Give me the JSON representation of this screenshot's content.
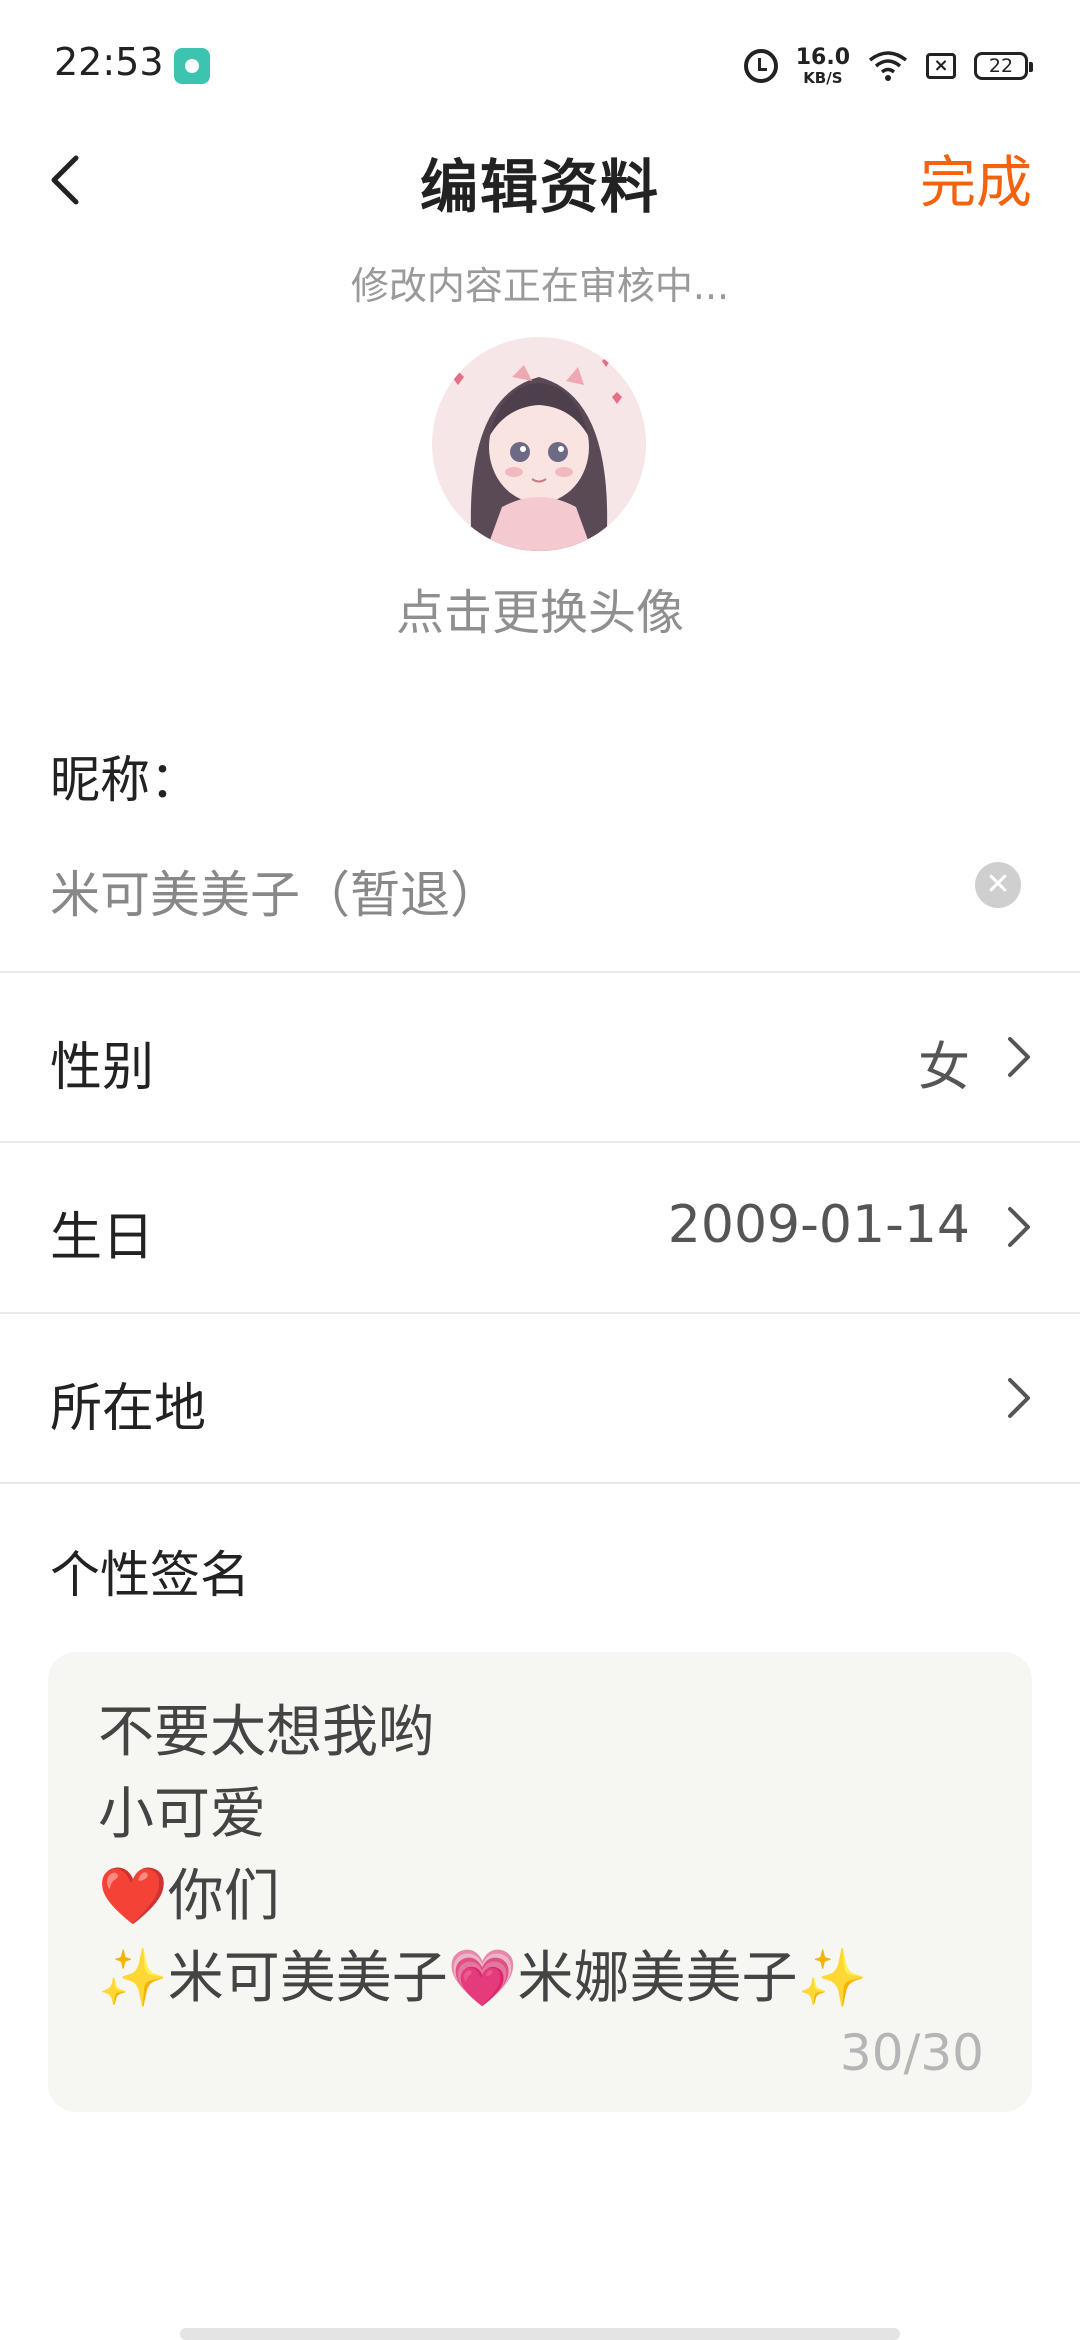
{
  "status_bar": {
    "time": "22:53",
    "net_speed_value": "16.0",
    "net_speed_unit": "KB/S",
    "battery_level": "22",
    "icons": [
      "app-notification-icon",
      "alarm-icon",
      "wifi-icon",
      "sim-icon",
      "battery-icon"
    ]
  },
  "header": {
    "title": "编辑资料",
    "done_label": "完成",
    "back_icon": "chevron-left-icon"
  },
  "review_notice": "修改内容正在审核中...",
  "avatar": {
    "caption": "点击更换头像"
  },
  "nickname": {
    "label": "昵称：",
    "value": "米可美美子（暂退）"
  },
  "rows": [
    {
      "label": "性别",
      "value": "女"
    },
    {
      "label": "生日",
      "value": "2009-01-14"
    },
    {
      "label": "所在地",
      "value": ""
    }
  ],
  "signature": {
    "label": "个性签名",
    "text": "不要太想我哟\n小可爱\n❤️你们\n✨米可美美子💗米娜美美子✨",
    "counter": "30/30"
  },
  "colors": {
    "accent": "#f2620f",
    "muted_text": "#9a9a9a",
    "signature_bg": "#f6f6f3"
  }
}
